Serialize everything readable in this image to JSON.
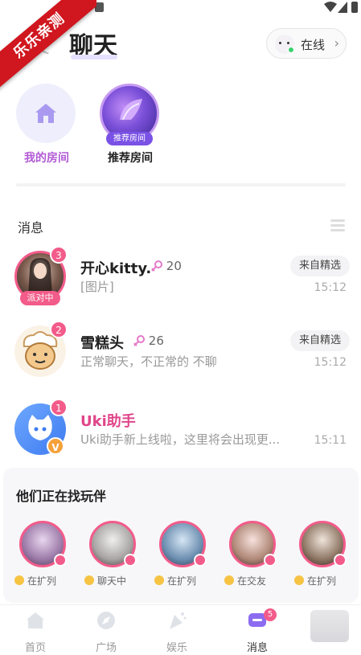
{
  "watermark": "乐乐亲测",
  "header": {
    "tab_prev": "友",
    "tab_active": "聊天",
    "online_label": "在线",
    "online_chevron": "›"
  },
  "rooms": [
    {
      "label": "我的房间",
      "icon": "house-icon"
    },
    {
      "label": "推荐房间",
      "tag": "推荐房间"
    }
  ],
  "messages_section": {
    "title": "消息",
    "items": [
      {
        "name": "开心kitty.",
        "level": "20",
        "preview": "[图片]",
        "source": "来自精选",
        "time": "15:12",
        "unread": "3",
        "party": "派对中"
      },
      {
        "name": "雪糕头",
        "level": "26",
        "preview": "正常聊天，不正常的 不聊",
        "source": "来自精选",
        "time": "15:12",
        "unread": "2"
      },
      {
        "name": "Uki助手",
        "preview": "Uki助手新上线啦，这里将会出现更...",
        "time": "15:11",
        "unread": "1",
        "badge": "V"
      }
    ]
  },
  "finder": {
    "title": "他们正在找玩伴",
    "people": [
      {
        "status": "在扩列"
      },
      {
        "status": "聊天中"
      },
      {
        "status": "在扩列"
      },
      {
        "status": "在交友"
      },
      {
        "status": "在扩列"
      }
    ]
  },
  "tabbar": {
    "items": [
      {
        "label": "首页",
        "icon": "home-icon"
      },
      {
        "label": "广场",
        "icon": "compass-icon"
      },
      {
        "label": "娱乐",
        "icon": "party-icon"
      },
      {
        "label": "消息",
        "icon": "message-icon",
        "active": true,
        "badge": "5"
      },
      {
        "label": "",
        "icon": "profile-icon"
      }
    ]
  },
  "colors": {
    "accent_pink": "#f25b8a",
    "accent_purple": "#b25ad6",
    "online_green": "#3ad16c"
  }
}
